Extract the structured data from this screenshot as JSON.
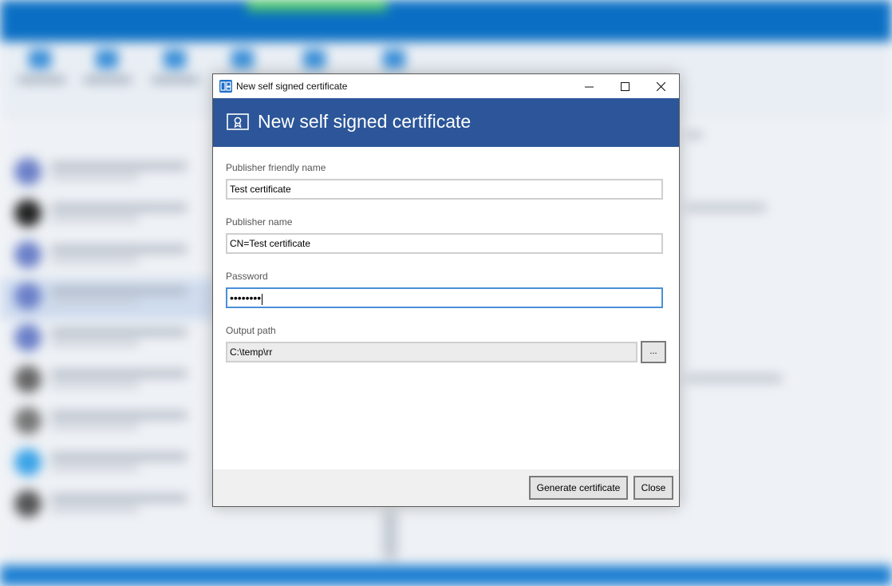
{
  "window": {
    "title": "New self signed certificate",
    "minimize_glyph": "—",
    "maximize_glyph": "☐",
    "close_glyph": "✕"
  },
  "header": {
    "title": "New self signed certificate",
    "icon": "certificate-icon",
    "background_color": "#2c5699"
  },
  "form": {
    "publisher_friendly_name": {
      "label": "Publisher friendly name",
      "value": "Test certificate"
    },
    "publisher_name": {
      "label": "Publisher name",
      "value": "CN=Test certificate"
    },
    "password": {
      "label": "Password",
      "value": "••••••••"
    },
    "output_path": {
      "label": "Output path",
      "value": "C:\\temp\\rr",
      "browse_label": "..."
    }
  },
  "footer": {
    "generate_label": "Generate certificate",
    "close_label": "Close"
  },
  "colors": {
    "accent": "#2c5699",
    "focus_border": "#4a90d6"
  }
}
